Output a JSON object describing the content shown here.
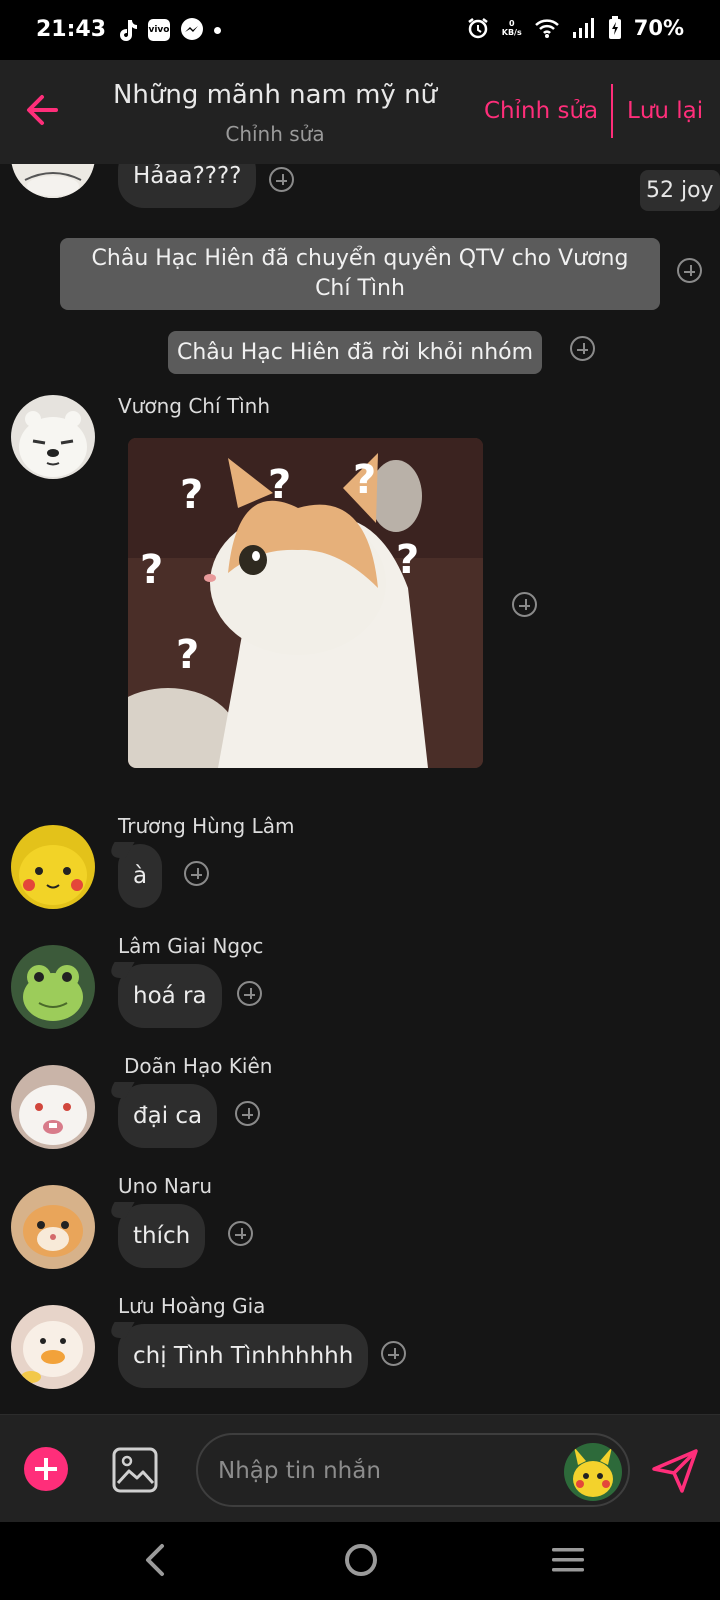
{
  "status_bar": {
    "time": "21:43",
    "net_speed_value": "0",
    "net_speed_unit": "KB/s",
    "battery": "70%",
    "icons": [
      "tiktok-icon",
      "vivo-icon",
      "messenger-icon",
      "alarm-icon",
      "wifi-icon",
      "signal-icon",
      "battery-charging-icon"
    ]
  },
  "header": {
    "title": "Những mãnh nam mỹ nữ",
    "subtitle": "Chỉnh sửa",
    "edit_label": "Chỉnh sửa",
    "save_label": "Lưu lại",
    "accent_color": "#ff2e7a"
  },
  "chat": {
    "badge": "52 joy",
    "first_message": "Hảaa????",
    "system_messages": [
      "Châu Hạc Hiên đã chuyển quyền QTV cho Vương Chí Tình",
      "Châu Hạc Hiên đã rời khỏi nhóm"
    ],
    "image_message": {
      "sender": "Vương Chí Tình",
      "image": "confused cat sticker",
      "question_marks": [
        "?",
        "?",
        "?",
        "?",
        "?",
        "?"
      ]
    },
    "messages": [
      {
        "sender": "Trương Hùng Lâm",
        "text": "à",
        "avatar": "pikachu-avatar"
      },
      {
        "sender": "Lâm Giai Ngọc",
        "text": "hoá ra",
        "avatar": "frog-avatar"
      },
      {
        "sender": "Doãn Hạo Kiên",
        "text": "đại ca",
        "avatar": "bunny-avatar"
      },
      {
        "sender": "Uno Naru",
        "text": "thích",
        "avatar": "cat-avatar"
      },
      {
        "sender": "Lưu Hoàng Gia",
        "text": "chị Tình Tìnhhhhhh",
        "avatar": "duck-avatar"
      }
    ]
  },
  "input_bar": {
    "placeholder": "Nhập tin nhắn"
  }
}
